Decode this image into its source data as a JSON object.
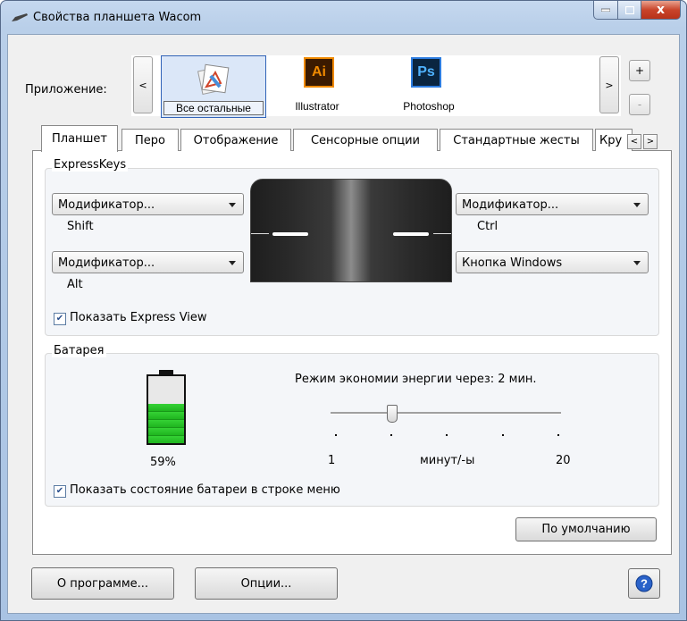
{
  "window": {
    "title": "Свойства планшета Wacom",
    "buttons": {
      "min": "–",
      "max": "□",
      "close": "x"
    }
  },
  "app_selector": {
    "label": "Приложение:",
    "prev": "<",
    "next": ">",
    "add": "+",
    "remove": "-",
    "apps": [
      {
        "name": "Все остальные",
        "icon": "all-apps-icon",
        "selected": true
      },
      {
        "name": "Illustrator",
        "icon_text": "Ai",
        "color": "#f08a00"
      },
      {
        "name": "Photoshop",
        "icon_text": "Ps",
        "color": "#2d7de0"
      }
    ]
  },
  "tabs": [
    {
      "label": "Планшет",
      "active": true
    },
    {
      "label": "Перо"
    },
    {
      "label": "Отображение"
    },
    {
      "label": "Сенсорные опции"
    },
    {
      "label": "Стандартные жесты"
    },
    {
      "label": "Кру"
    }
  ],
  "tab_arrows": {
    "left": "<",
    "right": ">"
  },
  "expresskeys": {
    "title": "ExpressKeys",
    "left_top": {
      "value": "Модификатор...",
      "sub": "Shift"
    },
    "left_bottom": {
      "value": "Модификатор...",
      "sub": "Alt"
    },
    "right_top": {
      "value": "Модификатор...",
      "sub": "Ctrl"
    },
    "right_bottom": {
      "value": "Кнопка Windows"
    },
    "show_express_view": {
      "label": "Показать Express View",
      "checked": true
    }
  },
  "battery": {
    "title": "Батарея",
    "level_percent": 59,
    "percent_text": "59%",
    "power_save_label": "Режим экономии энергии через: 2 мин.",
    "slider": {
      "value": 2,
      "min": 1,
      "max": 20,
      "min_label": "1",
      "max_label": "20",
      "unit": "минут/-ы"
    },
    "show_battery_status": {
      "label": "Показать состояние батареи в строке меню",
      "checked": true
    }
  },
  "default_button": "По умолчанию",
  "about_button": "О программе...",
  "options_button": "Опции...",
  "help_icon": "help-icon",
  "colors": {
    "accent": "#3264b8",
    "battery": "#2ecc2e"
  }
}
